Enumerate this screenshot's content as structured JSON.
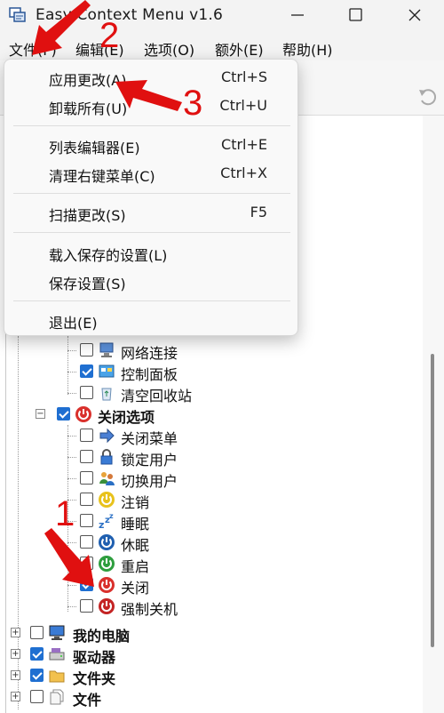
{
  "window": {
    "title": "Easy Context Menu v1.6"
  },
  "menubar": {
    "items": [
      {
        "label": "文件(F)"
      },
      {
        "label": "编辑(E)"
      },
      {
        "label": "选项(O)"
      },
      {
        "label": "额外(E)"
      },
      {
        "label": "帮助(H)"
      }
    ]
  },
  "file_menu": {
    "items": [
      {
        "label": "应用更改(A)",
        "shortcut": "Ctrl+S"
      },
      {
        "label": "卸载所有(U)",
        "shortcut": "Ctrl+U"
      },
      {
        "label": "列表编辑器(E)",
        "shortcut": "Ctrl+E"
      },
      {
        "label": "清理右键菜单(C)",
        "shortcut": "Ctrl+X"
      },
      {
        "label": "扫描更改(S)",
        "shortcut": "F5"
      },
      {
        "label": "载入保存的设置(L)",
        "shortcut": ""
      },
      {
        "label": "保存设置(S)",
        "shortcut": ""
      },
      {
        "label": "退出(E)",
        "shortcut": ""
      }
    ]
  },
  "tree": {
    "items": [
      {
        "label": "网络连接",
        "checked": false,
        "icon": "network-icon"
      },
      {
        "label": "控制面板",
        "checked": true,
        "icon": "control-panel-icon"
      },
      {
        "label": "清空回收站",
        "checked": false,
        "icon": "recycle-bin-icon"
      },
      {
        "label": "关闭选项",
        "checked": true,
        "icon": "power-icon"
      },
      {
        "label": "关闭菜单",
        "checked": false,
        "icon": "arrow-right-icon"
      },
      {
        "label": "锁定用户",
        "checked": false,
        "icon": "lock-icon"
      },
      {
        "label": "切换用户",
        "checked": false,
        "icon": "switch-user-icon"
      },
      {
        "label": "注销",
        "checked": false,
        "icon": "logoff-icon"
      },
      {
        "label": "睡眠",
        "checked": false,
        "icon": "sleep-icon"
      },
      {
        "label": "休眠",
        "checked": false,
        "icon": "hibernate-icon"
      },
      {
        "label": "重启",
        "checked": false,
        "icon": "restart-icon"
      },
      {
        "label": "关闭",
        "checked": true,
        "icon": "shutdown-icon"
      },
      {
        "label": "强制关机",
        "checked": false,
        "icon": "force-shutdown-icon"
      },
      {
        "label": "我的电脑",
        "checked": false,
        "icon": "computer-icon"
      },
      {
        "label": "驱动器",
        "checked": true,
        "icon": "drive-icon"
      },
      {
        "label": "文件夹",
        "checked": true,
        "icon": "folder-icon"
      },
      {
        "label": "文件",
        "checked": false,
        "icon": "file-icon"
      }
    ]
  },
  "annotations": {
    "n1": "1",
    "n2": "2",
    "n3": "3"
  },
  "colors": {
    "annotation": "#e01010",
    "check": "#1f6fd1"
  }
}
